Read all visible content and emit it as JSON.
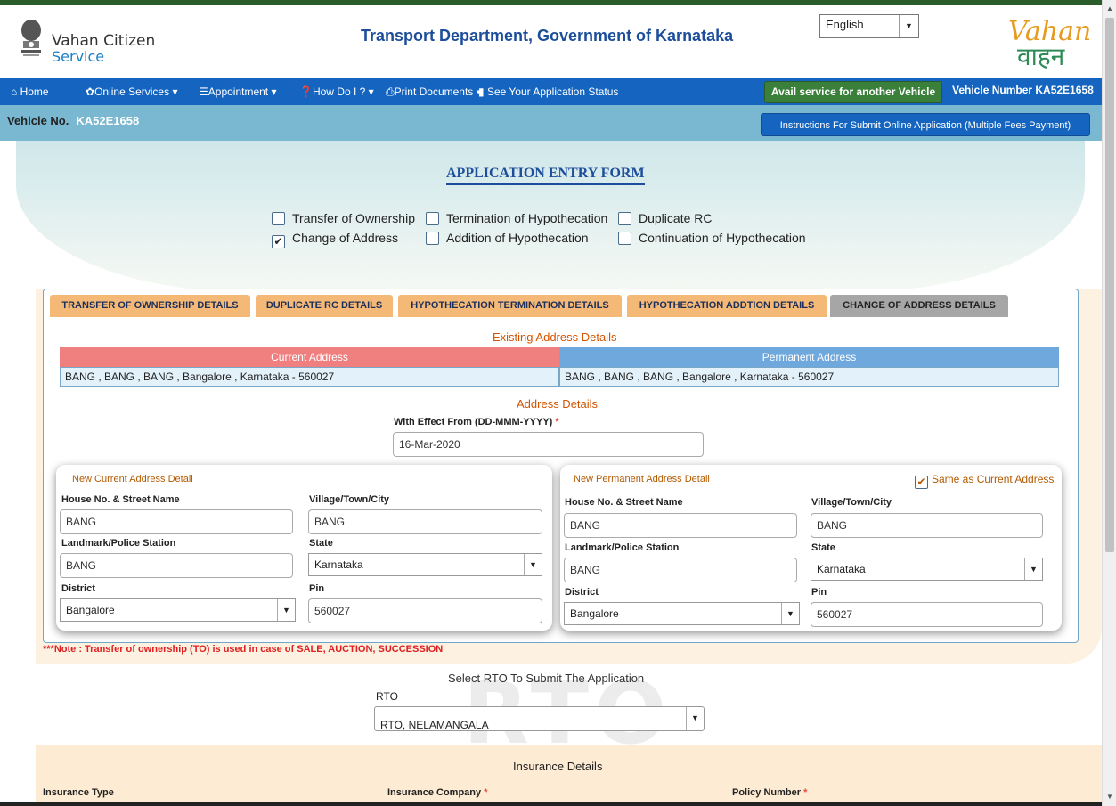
{
  "header": {
    "brand_line1": "Vahan Citizen",
    "brand_line2": "Service",
    "dept_title": "Transport Department, Government of Karnataka",
    "language": "English",
    "logo_line1": "Vahan",
    "logo_line2": "वाहन"
  },
  "nav": {
    "home": "Home",
    "online_services": "Online Services",
    "appointment": "Appointment",
    "how_do_i": "How Do I ?",
    "print_documents": "Print Documents",
    "see_status": "See Your Application Status",
    "avail_button": "Avail service for another Vehicle",
    "vehicle_number_label": "Vehicle Number KA52E1658"
  },
  "subbar": {
    "vehicle_no_label": "Vehicle No.",
    "vehicle_no": "KA52E1658",
    "instructions_button": "Instructions For Submit Online Application (Multiple Fees Payment)"
  },
  "form": {
    "title": "APPLICATION ENTRY FORM",
    "checkboxes": [
      {
        "label": "Transfer of Ownership",
        "checked": false
      },
      {
        "label": "Termination of Hypothecation",
        "checked": false
      },
      {
        "label": "Duplicate RC",
        "checked": false
      },
      {
        "label": "Change of Address",
        "checked": true
      },
      {
        "label": "Addition of Hypothecation",
        "checked": false
      },
      {
        "label": "Continuation of Hypothecation",
        "checked": false
      }
    ]
  },
  "tabs": [
    {
      "label": "TRANSFER OF OWNERSHIP DETAILS",
      "active": false
    },
    {
      "label": "DUPLICATE RC DETAILS",
      "active": false
    },
    {
      "label": "HYPOTHECATION TERMINATION DETAILS",
      "active": false
    },
    {
      "label": "HYPOTHECATION ADDTION DETAILS",
      "active": false
    },
    {
      "label": "CHANGE OF ADDRESS DETAILS",
      "active": true
    }
  ],
  "existing": {
    "title": "Existing Address Details",
    "current_header": "Current Address",
    "permanent_header": "Permanent Address",
    "current_value": "BANG , BANG , BANG , Bangalore , Karnataka - 560027",
    "permanent_value": "BANG , BANG , BANG , Bangalore , Karnataka - 560027"
  },
  "address_details": {
    "title": "Address Details",
    "effect_label": "With Effect From (DD-MMM-YYYY)",
    "effect_value": "16-Mar-2020"
  },
  "current_card": {
    "title": "New Current Address Detail",
    "house_label": "House No. & Street Name",
    "house_value": "BANG",
    "village_label": "Village/Town/City",
    "village_value": "BANG",
    "landmark_label": "Landmark/Police Station",
    "landmark_value": "BANG",
    "state_label": "State",
    "state_value": "Karnataka",
    "district_label": "District",
    "district_value": "Bangalore",
    "pin_label": "Pin",
    "pin_value": "560027"
  },
  "permanent_card": {
    "title": "New Permanent Address Detail",
    "same_as_label": "Same as Current Address",
    "same_as_checked": true,
    "house_label": "House No. & Street Name",
    "house_value": "BANG",
    "village_label": "Village/Town/City",
    "village_value": "BANG",
    "landmark_label": "Landmark/Police Station",
    "landmark_value": "BANG",
    "state_label": "State",
    "state_value": "Karnataka",
    "district_label": "District",
    "district_value": "Bangalore",
    "pin_label": "Pin",
    "pin_value": "560027"
  },
  "note": "***Note : Transfer of ownership (TO) is used in case of SALE, AUCTION, SUCCESSION",
  "rto": {
    "title": "Select RTO To Submit The Application",
    "label": "RTO",
    "value": "RTO, NELAMANGALA",
    "watermark": "RTO"
  },
  "insurance": {
    "title": "Insurance Details",
    "type_label": "Insurance Type",
    "company_label": "Insurance Company",
    "policy_label": "Policy Number"
  },
  "colors": {
    "nav_blue": "#1565c0",
    "tab_orange": "#f5b977",
    "current_header": "#f08080",
    "permanent_header": "#6fa8dc"
  }
}
